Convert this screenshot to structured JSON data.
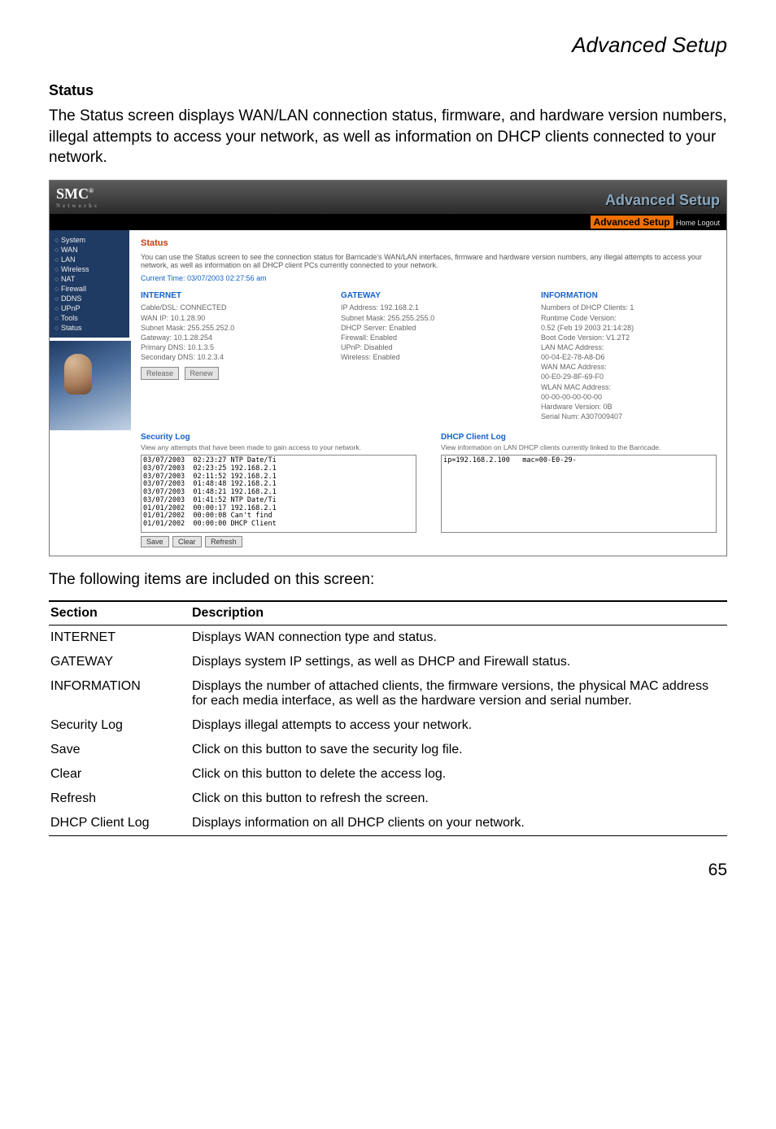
{
  "page_title": "Advanced Setup",
  "section_heading": "Status",
  "intro_text": "The Status screen displays WAN/LAN connection status, firmware, and hardware version numbers, illegal attempts to access your network, as well as information on DHCP clients connected to your network.",
  "router_shot": {
    "brand_main": "SMC",
    "brand_sub": "Networks",
    "header_gradient_text": "Advanced Setup",
    "subheader_setup": "Advanced Setup",
    "subheader_links": "Home   Logout",
    "sidebar_items": [
      "System",
      "WAN",
      "LAN",
      "Wireless",
      "NAT",
      "Firewall",
      "DDNS",
      "UPnP",
      "Tools",
      "Status"
    ],
    "main_title": "Status",
    "main_desc": "You can use the Status screen to see the connection status for Barricade's WAN/LAN interfaces, firmware and hardware version numbers, any illegal attempts to access your network, as well as information on all DHCP client PCs currently connected to your network.",
    "current_time": "Current Time: 03/07/2003 02:27:56 am",
    "col_internet": {
      "title": "INTERNET",
      "lines": [
        "Cable/DSL:  CONNECTED",
        "WAN IP:  10.1.28.90",
        "Subnet Mask:  255.255.252.0",
        "Gateway:  10.1.28.254",
        "Primary DNS:  10.1.3.5",
        "Secondary DNS:  10.2.3.4"
      ],
      "btn_release": "Release",
      "btn_renew": "Renew"
    },
    "col_gateway": {
      "title": "GATEWAY",
      "lines": [
        "IP Address:  192.168.2.1",
        "Subnet Mask:  255.255.255.0",
        "DHCP Server:  Enabled",
        "Firewall:  Enabled",
        "UPnP:  Disabled",
        "Wireless:  Enabled"
      ]
    },
    "col_info": {
      "title": "INFORMATION",
      "lines": [
        "Numbers of DHCP Clients:  1",
        "Runtime Code Version:",
        "   0.52 (Feb 19 2003 21:14:28)",
        "Boot Code Version:  V1.2T2",
        "LAN MAC Address:",
        "   00-04-E2-78-A8-D6",
        "WAN MAC Address:",
        "   00-E0-29-8F-69-F0",
        "WLAN MAC Address:",
        "   00-00-00-00-00-00",
        "Hardware Version:  0B",
        "Serial Num:  A307009407"
      ]
    },
    "security_log": {
      "title": "Security Log",
      "sub": "View any attempts that have been made to gain access to your network.",
      "content": "03/07/2003  02:23:27 NTP Date/Ti\n03/07/2003  02:23:25 192.168.2.1\n03/07/2003  02:11:52 192.168.2.1\n03/07/2003  01:48:48 192.168.2.1\n03/07/2003  01:48:21 192.168.2.1\n03/07/2003  01:41:52 NTP Date/Ti\n01/01/2002  00:00:17 192.168.2.1\n01/01/2002  00:00:08 Can't find\n01/01/2002  00:00:00 DHCP Client",
      "btn_save": "Save",
      "btn_clear": "Clear",
      "btn_refresh": "Refresh"
    },
    "dhcp_log": {
      "title": "DHCP Client Log",
      "sub": "View information on LAN DHCP clients currently linked to the Barricade.",
      "content": "ip=192.168.2.100   mac=00-E0-29-"
    }
  },
  "following_text": "The following items are included on this screen:",
  "table": {
    "head_section": "Section",
    "head_description": "Description",
    "rows": [
      {
        "section": "INTERNET",
        "desc": "Displays WAN connection type and status."
      },
      {
        "section": "GATEWAY",
        "desc": "Displays system IP settings, as well as DHCP and Firewall status."
      },
      {
        "section": "INFORMATION",
        "desc": "Displays the number of attached clients, the firmware versions, the physical MAC address for each media interface, as well as the hardware version and serial number."
      },
      {
        "section": "Security Log",
        "desc": "Displays illegal attempts to access your network."
      },
      {
        "section": "Save",
        "desc": "Click on this button to save the security log file."
      },
      {
        "section": "Clear",
        "desc": "Click on this button to delete the access log."
      },
      {
        "section": "Refresh",
        "desc": "Click on this button to refresh the screen."
      },
      {
        "section": "DHCP Client Log",
        "desc": "Displays information on all DHCP clients on your network."
      }
    ]
  },
  "page_number": "65"
}
